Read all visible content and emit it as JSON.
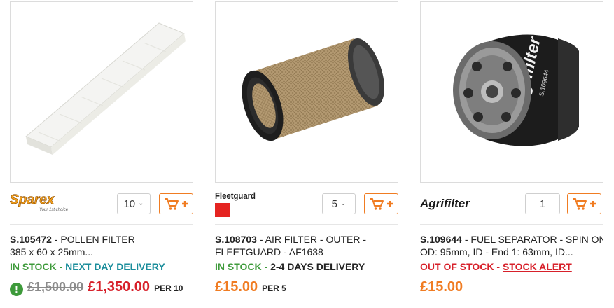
{
  "products": [
    {
      "brand": "Sparex",
      "brand_tagline": "Your 1st choice",
      "qty": "10",
      "sku": "S.105472",
      "desc_line1": " - POLLEN FILTER",
      "desc_line2": "385 x 60 x 25mm...",
      "stock_status": "IN STOCK",
      "stock_sep": " - ",
      "delivery": "NEXT DAY DELIVERY",
      "old_price": "£1,500.00",
      "price": "£1,350.00",
      "per": "PER 10"
    },
    {
      "brand": "Fleetguard",
      "qty": "5",
      "sku": "S.108703",
      "desc_line1": " - AIR FILTER - OUTER -",
      "desc_line2": "FLEETGUARD - AF1638",
      "stock_status": "IN STOCK",
      "stock_sep": " - ",
      "delivery": "2-4 DAYS DELIVERY",
      "price": "£15.00",
      "per": "PER 5"
    },
    {
      "brand": "Agrifilter",
      "qty": "1",
      "sku": "S.109644",
      "desc_line1": " - FUEL SEPARATOR - SPIN ON",
      "desc_line2": "OD: 95mm, ID - End 1: 63mm, ID...",
      "stock_status": "OUT OF STOCK",
      "stock_sep": " - ",
      "alert": "STOCK ALERT",
      "price": "£15.00",
      "filter_label": "Agrifilter",
      "filter_code": "S.109644"
    }
  ],
  "colors": {
    "accent_orange": "#f07c22",
    "in_stock_green": "#3d9a3a",
    "delivery_teal": "#1a8d9b",
    "sale_red": "#d7202a"
  },
  "icons": {
    "cart": "cart-plus-icon",
    "dropdown": "chevron-down-icon",
    "alert": "exclamation-circle-icon"
  }
}
